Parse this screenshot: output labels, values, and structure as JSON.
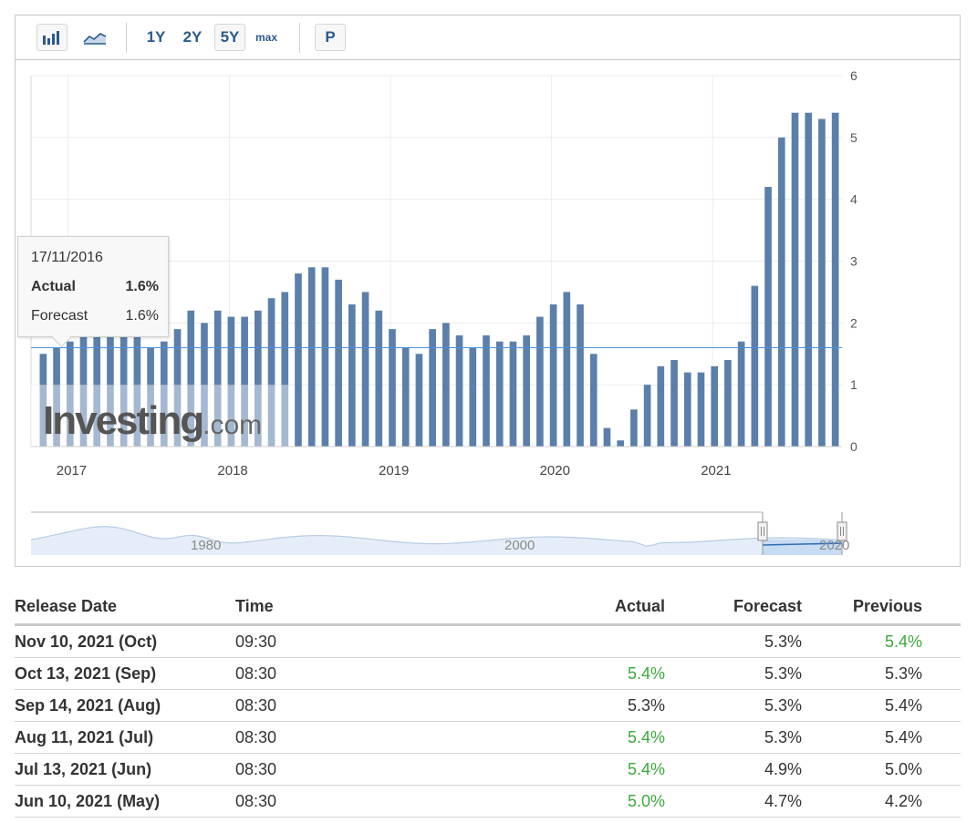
{
  "toolbar": {
    "ranges": [
      "1Y",
      "2Y",
      "5Y",
      "max"
    ],
    "selected_range": "5Y",
    "p_label": "P",
    "icons": [
      "bar-chart-icon",
      "area-chart-icon"
    ]
  },
  "tooltip": {
    "date": "17/11/2016",
    "actual_label": "Actual",
    "actual_value": "1.6%",
    "forecast_label": "Forecast",
    "forecast_value": "1.6%"
  },
  "watermark": {
    "main": "Investing",
    "suffix": ".com"
  },
  "colors": {
    "bar": "#5b7fab",
    "bar_light": "#b3c3d8",
    "reference_line": "#4a90d9",
    "green": "#3aa93a",
    "toolbar_text": "#2a5a8c"
  },
  "chart_data": {
    "type": "bar",
    "values": [
      1.5,
      1.6,
      1.7,
      1.8,
      1.8,
      1.8,
      1.8,
      1.8,
      1.6,
      1.7,
      1.9,
      2.2,
      2.0,
      2.2,
      2.1,
      2.1,
      2.2,
      2.4,
      2.5,
      2.8,
      2.9,
      2.9,
      2.7,
      2.3,
      2.5,
      2.2,
      1.9,
      1.6,
      1.5,
      1.9,
      2.0,
      1.8,
      1.6,
      1.8,
      1.7,
      1.7,
      1.8,
      2.1,
      2.3,
      2.5,
      2.3,
      1.5,
      0.3,
      0.1,
      0.6,
      1.0,
      1.3,
      1.4,
      1.2,
      1.2,
      1.3,
      1.4,
      1.7,
      2.6,
      4.2,
      5.0,
      5.4,
      5.4,
      5.3,
      5.4
    ],
    "x_labels": [
      "2017",
      "2018",
      "2019",
      "2020",
      "2021"
    ],
    "yticks": [
      "0",
      "1",
      "2",
      "3",
      "4",
      "5",
      "6"
    ],
    "ylim": [
      0,
      6
    ],
    "reference_value": 1.6,
    "grid": true,
    "navigator_labels": [
      "1980",
      "2000",
      "2020"
    ]
  },
  "table": {
    "headers": {
      "date": "Release Date",
      "time": "Time",
      "actual": "Actual",
      "forecast": "Forecast",
      "previous": "Previous"
    },
    "rows": [
      {
        "date": "Nov 10, 2021 (Oct)",
        "time": "09:30",
        "actual": "",
        "forecast": "5.3%",
        "previous": "5.4%",
        "actual_green": false,
        "previous_green": true
      },
      {
        "date": "Oct 13, 2021 (Sep)",
        "time": "08:30",
        "actual": "5.4%",
        "forecast": "5.3%",
        "previous": "5.3%",
        "actual_green": true,
        "previous_green": false
      },
      {
        "date": "Sep 14, 2021 (Aug)",
        "time": "08:30",
        "actual": "5.3%",
        "forecast": "5.3%",
        "previous": "5.4%",
        "actual_green": false,
        "previous_green": false
      },
      {
        "date": "Aug 11, 2021 (Jul)",
        "time": "08:30",
        "actual": "5.4%",
        "forecast": "5.3%",
        "previous": "5.4%",
        "actual_green": true,
        "previous_green": false
      },
      {
        "date": "Jul 13, 2021 (Jun)",
        "time": "08:30",
        "actual": "5.4%",
        "forecast": "4.9%",
        "previous": "5.0%",
        "actual_green": true,
        "previous_green": false
      },
      {
        "date": "Jun 10, 2021 (May)",
        "time": "08:30",
        "actual": "5.0%",
        "forecast": "4.7%",
        "previous": "4.2%",
        "actual_green": true,
        "previous_green": false
      }
    ]
  }
}
